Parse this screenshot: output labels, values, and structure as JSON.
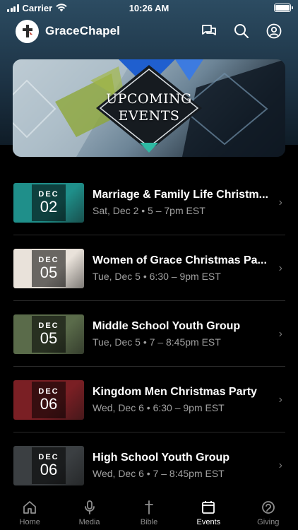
{
  "status_bar": {
    "carrier": "Carrier",
    "time": "10:26 AM"
  },
  "header": {
    "app_name": "GraceChapel"
  },
  "banner": {
    "line1": "UPCOMING",
    "line2": "EVENTS"
  },
  "events": [
    {
      "title": "Marriage & Family Life Christm...",
      "subtitle": "Sat, Dec 2 • 5 – 7pm EST",
      "month": "DEC",
      "day": "02",
      "thumb_color": "#1f8f8a"
    },
    {
      "title": "Women of Grace Christmas Pa...",
      "subtitle": "Tue, Dec 5 • 6:30 – 9pm EST",
      "month": "DEC",
      "day": "05",
      "thumb_color": "#e9e2da"
    },
    {
      "title": "Middle School Youth Group",
      "subtitle": "Tue, Dec 5 • 7 – 8:45pm EST",
      "month": "DEC",
      "day": "05",
      "thumb_color": "#5a6b4a"
    },
    {
      "title": "Kingdom Men Christmas Party",
      "subtitle": "Wed, Dec 6 • 6:30 – 9pm EST",
      "month": "DEC",
      "day": "06",
      "thumb_color": "#7a1f24"
    },
    {
      "title": "High School Youth Group",
      "subtitle": "Wed, Dec 6 • 7 – 8:45pm EST",
      "month": "DEC",
      "day": "06",
      "thumb_color": "#3b3f42"
    }
  ],
  "tabs": [
    {
      "label": "Home",
      "icon": "home-icon",
      "active": false
    },
    {
      "label": "Media",
      "icon": "microphone-icon",
      "active": false
    },
    {
      "label": "Bible",
      "icon": "cross-icon",
      "active": false
    },
    {
      "label": "Events",
      "icon": "calendar-icon",
      "active": true
    },
    {
      "label": "Giving",
      "icon": "giving-icon",
      "active": false
    }
  ]
}
